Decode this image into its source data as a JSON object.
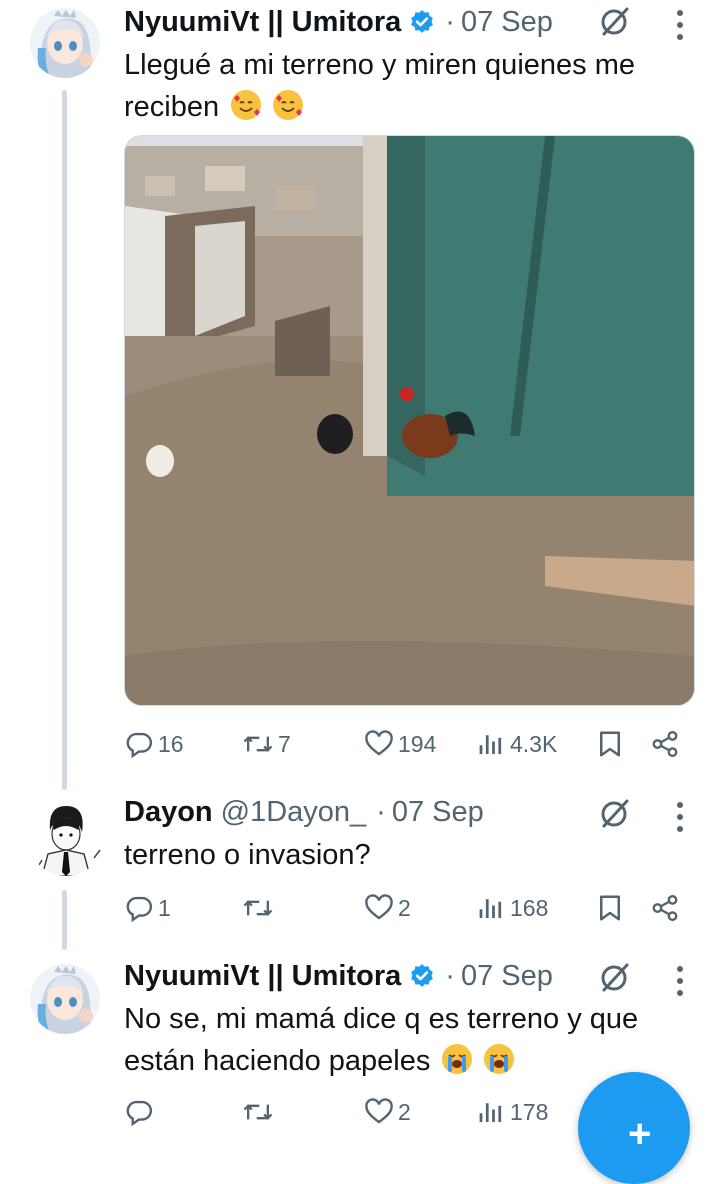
{
  "posts": [
    {
      "author_name": "NyuumiVt || Umitora",
      "handle": "",
      "separator": "·",
      "date": "07 Sep",
      "verified": true,
      "text_lines": [
        "Llegué a mi terreno y miren quienes me",
        "reciben"
      ],
      "emojis": [
        "smiling-face-with-hearts",
        "smiling-face-with-hearts"
      ],
      "has_media": true,
      "stats": {
        "replies": "16",
        "reposts": "7",
        "likes": "194",
        "views": "4.3K"
      }
    },
    {
      "author_name": "Dayon",
      "handle": "@1Dayon_",
      "separator": "·",
      "date": "07 Sep",
      "verified": false,
      "text_lines": [
        "terreno o invasion?"
      ],
      "emojis": [],
      "has_media": false,
      "stats": {
        "replies": "1",
        "reposts": "",
        "likes": "2",
        "views": "168"
      }
    },
    {
      "author_name": "NyuumiVt || Umitora",
      "handle": "",
      "separator": "·",
      "date": "07 Sep",
      "verified": true,
      "text_lines": [
        "No se, mi mamá dice q es terreno y que",
        "están haciendo papeles"
      ],
      "emojis": [
        "loudly-crying-face",
        "loudly-crying-face"
      ],
      "has_media": false,
      "stats": {
        "replies": "",
        "reposts": "",
        "likes": "2",
        "views": "178"
      }
    }
  ],
  "icons": {
    "reply": "speech-bubble-icon",
    "repost": "repost-arrows-icon",
    "like": "heart-icon",
    "views": "bar-chart-icon",
    "bookmark": "bookmark-icon",
    "share": "share-nodes-icon",
    "grok": "slashed-circle-icon",
    "more": "vertical-dots-icon",
    "compose": "plus-icon"
  },
  "colors": {
    "accent": "#1d9bf0",
    "text": "#0f1419",
    "muted": "#536471",
    "thread_line": "#cfd9de"
  }
}
